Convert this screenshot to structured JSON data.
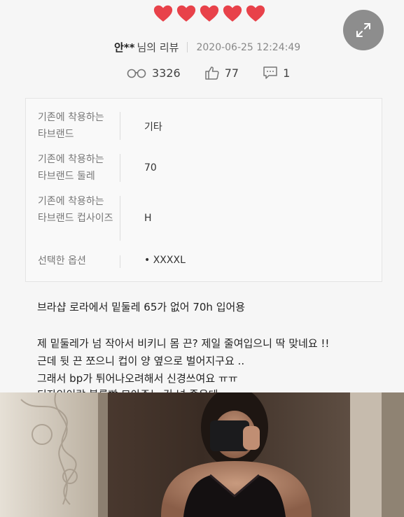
{
  "rating": {
    "stars": 5,
    "max": 5,
    "color": "#e8424a"
  },
  "review_meta": {
    "user": "안**",
    "suffix": "님의 리뷰",
    "date": "2020-06-25 12:24:49"
  },
  "stats": {
    "views": "3326",
    "likes": "77",
    "comments": "1"
  },
  "info": [
    {
      "label": "기존에 착용하는 타브랜드",
      "value": "기타"
    },
    {
      "label": "기존에 착용하는 타브랜드 둘레",
      "value": "70"
    },
    {
      "label": "기존에 착용하는 타브랜드 컵사이즈",
      "value": "H"
    },
    {
      "label": "선택한 옵션",
      "value": "• XXXXL"
    }
  ],
  "review_lines": [
    "브라샵 로라에서 밑둘레 65가 없어 70h 입어용",
    "제 밑둘레가 넘 작아서 비키니 몸 끈? 제일 줄여입으니 딱 맞네요 !!",
    "근데 뒷 끈 쪼으니 컵이 양 옆으로 벌어지구요 ..",
    "그래서 bp가 튀어나오려해서 신경쓰여요 ㅠㅠ",
    "디자인이랑 볼륨빵 모아주는 건 넘 좋은데"
  ]
}
